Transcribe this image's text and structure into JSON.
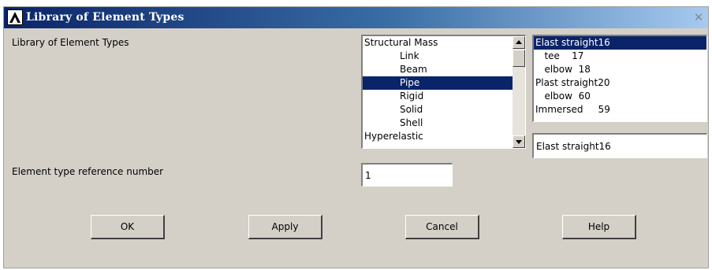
{
  "window": {
    "title": "Library of Element Types",
    "close_glyph": "✕"
  },
  "library": {
    "label": "Library of Element Types",
    "categories": [
      {
        "label": "Structural Mass",
        "indent": false,
        "selected": false
      },
      {
        "label": "Link",
        "indent": true,
        "selected": false
      },
      {
        "label": "Beam",
        "indent": true,
        "selected": false
      },
      {
        "label": "Pipe",
        "indent": true,
        "selected": true
      },
      {
        "label": "Rigid",
        "indent": true,
        "selected": false
      },
      {
        "label": "Solid",
        "indent": true,
        "selected": false
      },
      {
        "label": "Shell",
        "indent": true,
        "selected": false
      },
      {
        "label": "Hyperelastic",
        "indent": false,
        "selected": false
      }
    ],
    "elements": [
      {
        "label": "Elast straight16",
        "selected": true
      },
      {
        "label": "   tee    17",
        "selected": false
      },
      {
        "label": "   elbow  18",
        "selected": false
      },
      {
        "label": "Plast straight20",
        "selected": false
      },
      {
        "label": "   elbow  60",
        "selected": false
      },
      {
        "label": "Immersed     59",
        "selected": false
      }
    ],
    "selected_element": "Elast straight16"
  },
  "reference": {
    "label": "Element type reference number",
    "value": "1"
  },
  "buttons": {
    "ok": "OK",
    "apply": "Apply",
    "cancel": "Cancel",
    "help": "Help"
  },
  "icons": {
    "logo": "ansys-logo-icon",
    "close": "close-icon",
    "scroll_up": "scroll-up-arrow-icon",
    "scroll_down": "scroll-down-arrow-icon"
  }
}
